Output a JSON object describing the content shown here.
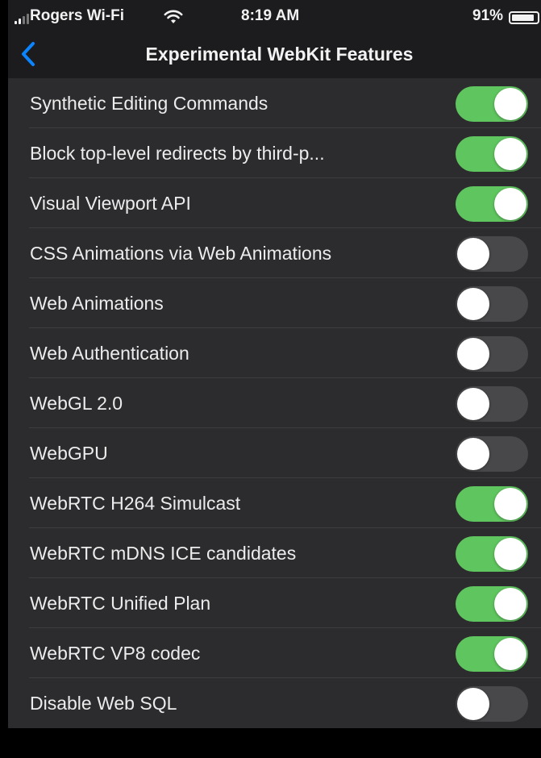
{
  "status_bar": {
    "carrier": "Rogers Wi-Fi",
    "time": "8:19 AM",
    "battery_percent": "91%",
    "signal_bars_active": 2,
    "wifi_icon": "wifi-icon",
    "battery_level": 0.91
  },
  "nav": {
    "title": "Experimental WebKit Features",
    "back_icon": "chevron-left-icon"
  },
  "colors": {
    "accent_on": "#5fc55e",
    "toggle_off": "#48484a",
    "back_chevron": "#0a84ff"
  },
  "settings": [
    {
      "label": "Synthetic Editing Commands",
      "enabled": true
    },
    {
      "label": "Block top-level redirects by third-p...",
      "enabled": true
    },
    {
      "label": "Visual Viewport API",
      "enabled": true
    },
    {
      "label": "CSS Animations via Web Animations",
      "enabled": false
    },
    {
      "label": "Web Animations",
      "enabled": false
    },
    {
      "label": "Web Authentication",
      "enabled": false
    },
    {
      "label": "WebGL 2.0",
      "enabled": false
    },
    {
      "label": "WebGPU",
      "enabled": false
    },
    {
      "label": "WebRTC H264 Simulcast",
      "enabled": true
    },
    {
      "label": "WebRTC mDNS ICE candidates",
      "enabled": true
    },
    {
      "label": "WebRTC Unified Plan",
      "enabled": true
    },
    {
      "label": "WebRTC VP8 codec",
      "enabled": true
    },
    {
      "label": "Disable Web SQL",
      "enabled": false
    }
  ]
}
